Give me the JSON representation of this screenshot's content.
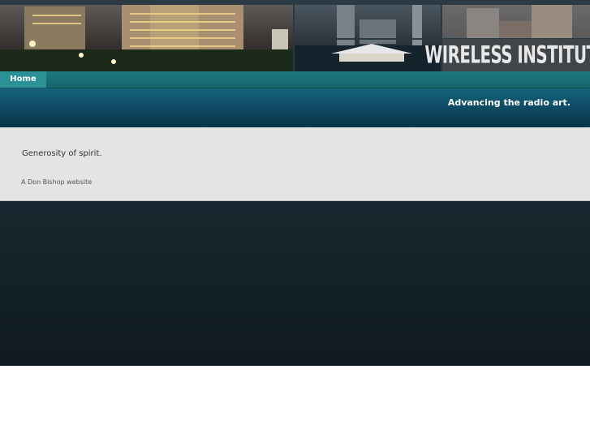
{
  "header": {
    "logo_text": "WIRELESS INSTITUTE"
  },
  "nav": {
    "items": [
      {
        "label": "Home"
      }
    ]
  },
  "band": {
    "tagline": "Advancing the radio art."
  },
  "content": {
    "main_text": "Generosity of spirit.",
    "credit": "A Don Bishop website"
  },
  "colors": {
    "nav": "#1d7a80",
    "nav_active": "#2a9197",
    "band": "#0e4a63",
    "content_bg": "#e4e4e4",
    "page_dark": "#1c2c35"
  }
}
